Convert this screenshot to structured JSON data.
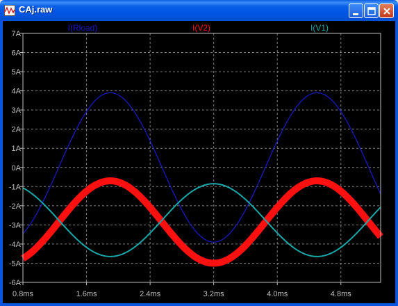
{
  "window": {
    "title": "CAj.raw",
    "buttons": [
      "minimize",
      "maximize",
      "close"
    ]
  },
  "chart_data": {
    "type": "line",
    "xlim": [
      0.8,
      5.3
    ],
    "ylim": [
      -6,
      7
    ],
    "x_ticks": [
      "0.8ms",
      "1.6ms",
      "2.4ms",
      "3.2ms",
      "4.0ms",
      "4.8ms"
    ],
    "x_tick_values": [
      0.8,
      1.6,
      2.4,
      3.2,
      4.0,
      4.8
    ],
    "y_ticks": [
      "7A",
      "6A",
      "5A",
      "4A",
      "3A",
      "2A",
      "1A",
      "0A",
      "-1A",
      "-2A",
      "-3A",
      "-4A",
      "-5A",
      "-6A"
    ],
    "y_tick_values": [
      7,
      6,
      5,
      4,
      3,
      2,
      1,
      0,
      -1,
      -2,
      -3,
      -4,
      -5,
      -6
    ],
    "grid": true,
    "background": "#000000",
    "legend_position": "top",
    "series": [
      {
        "name": "I(Rload)",
        "color": "#1a1acc",
        "offset": 0,
        "amplitude": 3.9,
        "period": 2.6,
        "phase_peak": 1.9,
        "stroke": 1.2
      },
      {
        "name": "I(V2)",
        "color": "#ff1010",
        "offset": -2.85,
        "amplitude": 2.15,
        "period": 2.6,
        "phase_peak": 1.9,
        "stroke": 10
      },
      {
        "name": "I(V1)",
        "color": "#1aa8a8",
        "offset": -2.75,
        "amplitude": 1.9,
        "period": 2.6,
        "phase_peak": 0.6,
        "stroke": 2
      }
    ]
  }
}
